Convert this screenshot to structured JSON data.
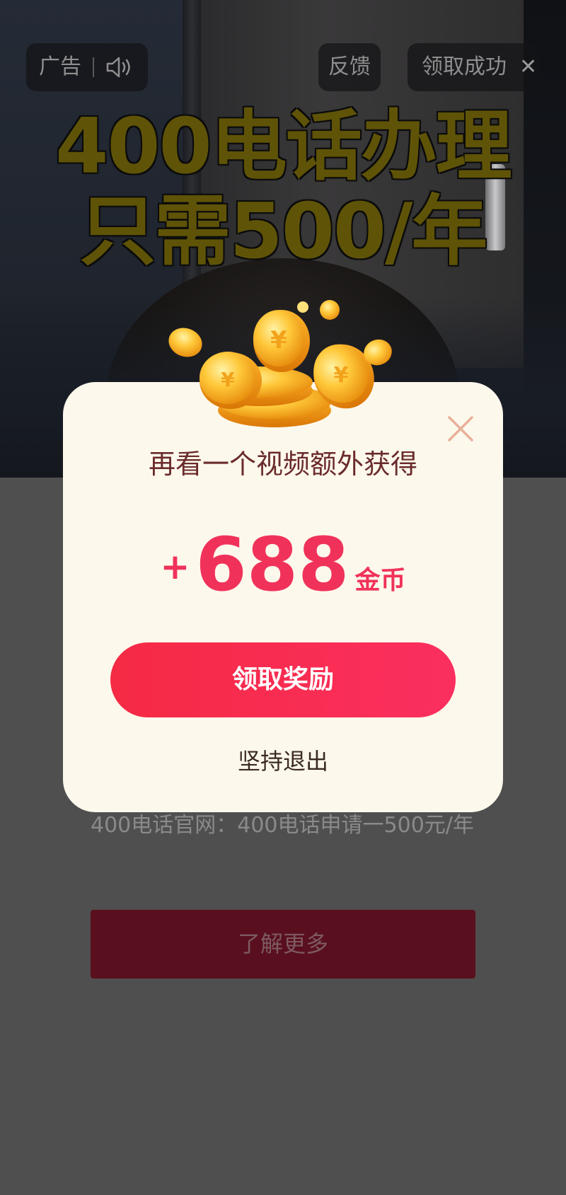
{
  "ad_bar": {
    "ad_label": "广告",
    "sound_icon": "speaker-icon",
    "feedback_label": "反馈",
    "success_label": "领取成功",
    "close_glyph": "✕"
  },
  "video": {
    "headline_line1": "400电话办理",
    "headline_line2": "只需500/年"
  },
  "page": {
    "description": "400电话官网：400电话申请一500元/年",
    "learn_more": "了解更多"
  },
  "dialog": {
    "title": "再看一个视频额外获得",
    "plus": "+",
    "amount": "688",
    "unit": "金币",
    "claim_button": "领取奖励",
    "quit_link": "坚持退出",
    "close_icon": "close-icon",
    "coins_icon": "gold-coins-icon"
  },
  "colors": {
    "accent": "#f0325a",
    "dialog_bg": "#fdf8ec",
    "title": "#6a2b2b",
    "headline": "#5f5307"
  }
}
